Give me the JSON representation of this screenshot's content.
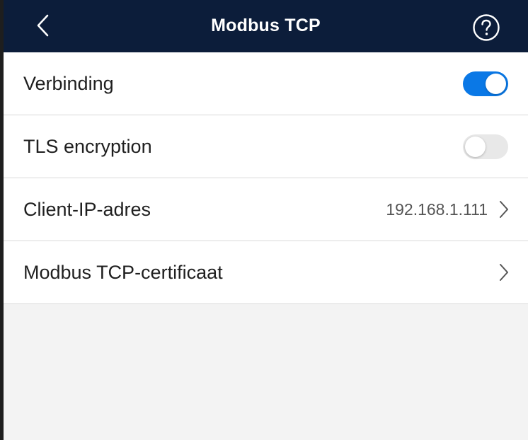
{
  "header": {
    "title": "Modbus TCP",
    "back_icon": "chevron-left-icon",
    "help_icon": "help-circle-icon",
    "background": "#0c1d3a"
  },
  "settings": {
    "connection": {
      "label": "Verbinding",
      "enabled": true
    },
    "tls": {
      "label": "TLS encryption",
      "enabled": false
    },
    "client_ip": {
      "label": "Client-IP-adres",
      "value": "192.168.1.111"
    },
    "certificate": {
      "label": "Modbus TCP-certificaat"
    }
  },
  "colors": {
    "toggle_on": "#0a78e6",
    "toggle_off": "#e8e8e8",
    "page_background": "#f3f3f3"
  }
}
